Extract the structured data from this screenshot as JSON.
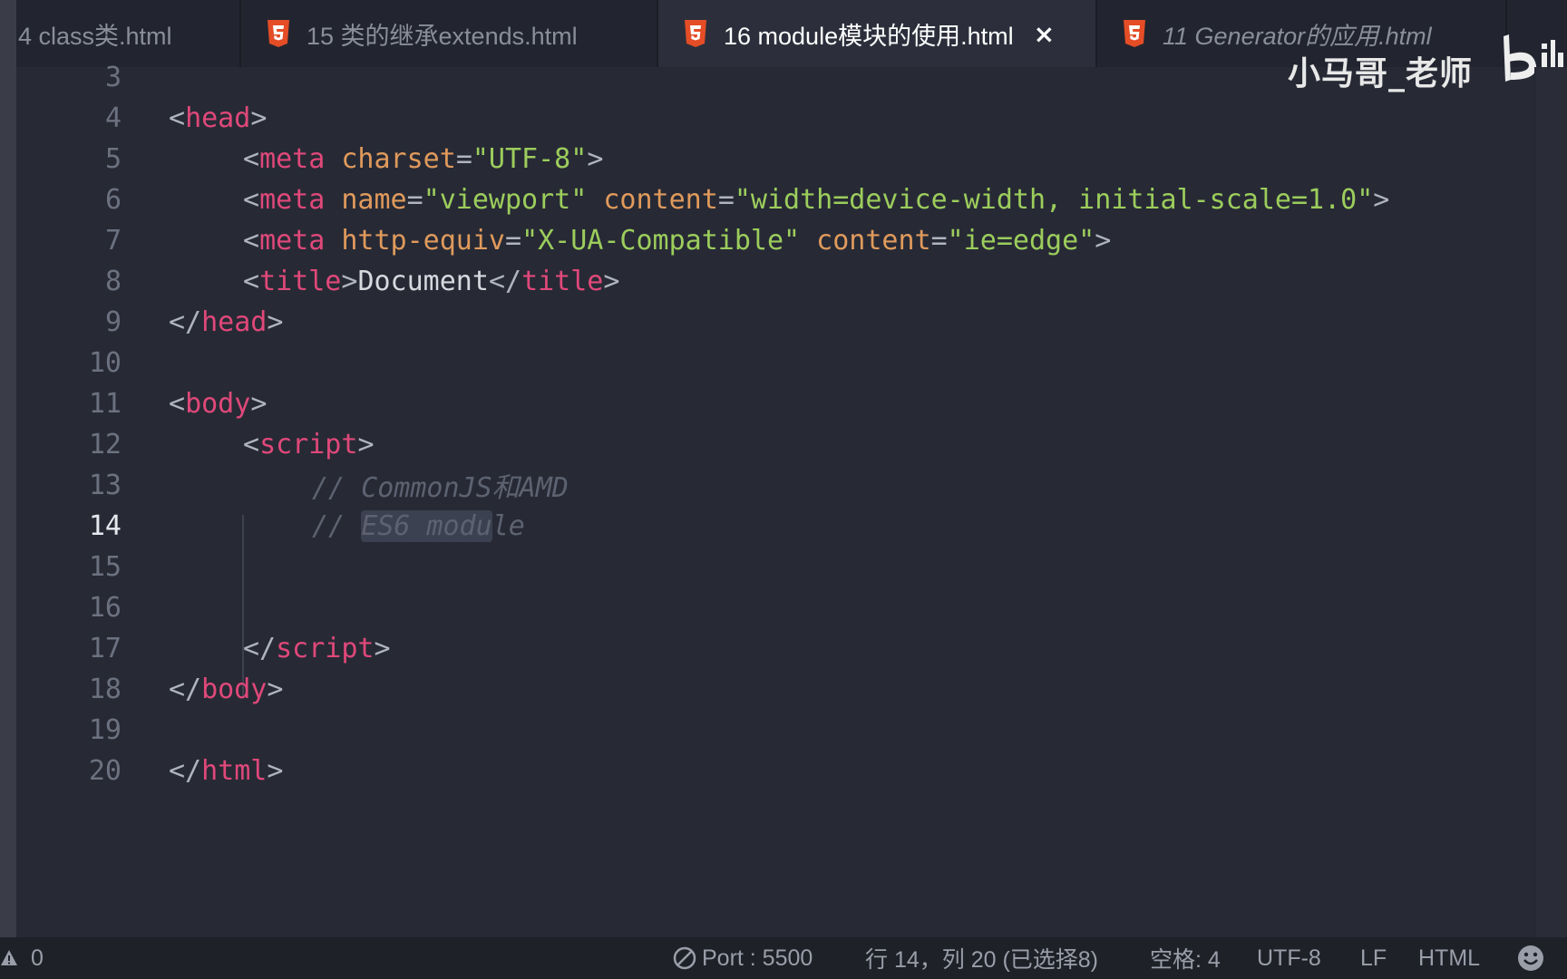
{
  "tabs": [
    {
      "label": "4 class类.html",
      "icon": "html5-icon",
      "active": false,
      "italic": false
    },
    {
      "label": "15 类的继承extends.html",
      "icon": "html5-icon",
      "active": false,
      "italic": false
    },
    {
      "label": "16 module模块的使用.html",
      "icon": "html5-icon",
      "active": true,
      "italic": false,
      "close": "×"
    },
    {
      "label": "11 Generator的应用.html",
      "icon": "html5-icon",
      "active": false,
      "italic": true
    }
  ],
  "watermark": {
    "text": "小马哥_老师"
  },
  "colors": {
    "tag": "#e0487a",
    "attribute": "#e09a5c",
    "string": "#9ccd5c",
    "comment": "#5d6271",
    "background": "#272a35",
    "html5_badge": "#e44d26"
  },
  "editor": {
    "current_line": "14",
    "lines": [
      {
        "num": "3"
      },
      {
        "num": "4",
        "t": [
          "<",
          "head",
          ">"
        ]
      },
      {
        "num": "5",
        "t": [
          "<",
          "meta",
          "charset",
          "=",
          "\"UTF-8\"",
          ">"
        ]
      },
      {
        "num": "6",
        "t": [
          "<",
          "meta",
          "name",
          "=",
          "\"viewport\"",
          "content",
          "=",
          "\"width=device-width, initial-scale=1.0\"",
          ">"
        ]
      },
      {
        "num": "7",
        "t": [
          "<",
          "meta",
          "http-equiv",
          "=",
          "\"X-UA-Compatible\"",
          "content",
          "=",
          "\"ie=edge\"",
          ">"
        ]
      },
      {
        "num": "8",
        "t": [
          "<",
          "title",
          ">",
          "Document",
          "</",
          "title",
          ">"
        ]
      },
      {
        "num": "9",
        "t": [
          "</",
          "head",
          ">"
        ]
      },
      {
        "num": "10"
      },
      {
        "num": "11",
        "t": [
          "<",
          "body",
          ">"
        ]
      },
      {
        "num": "12",
        "t": [
          "<",
          "script",
          ">"
        ]
      },
      {
        "num": "13",
        "t": [
          "// CommonJS和AMD"
        ]
      },
      {
        "num": "14",
        "t": [
          "// ",
          "ES6 modu",
          "le"
        ]
      },
      {
        "num": "15"
      },
      {
        "num": "16"
      },
      {
        "num": "17",
        "t": [
          "</",
          "script",
          ">"
        ]
      },
      {
        "num": "18",
        "t": [
          "</",
          "body",
          ">"
        ]
      },
      {
        "num": "19"
      },
      {
        "num": "20",
        "t": [
          "</",
          "html",
          ">"
        ]
      }
    ]
  },
  "status": {
    "problems_count": "0",
    "port": "Port : 5500",
    "cursor": "行 14，列 20 (已选择8)",
    "indent": "空格: 4",
    "encoding": "UTF-8",
    "eol": "LF",
    "language": "HTML"
  }
}
